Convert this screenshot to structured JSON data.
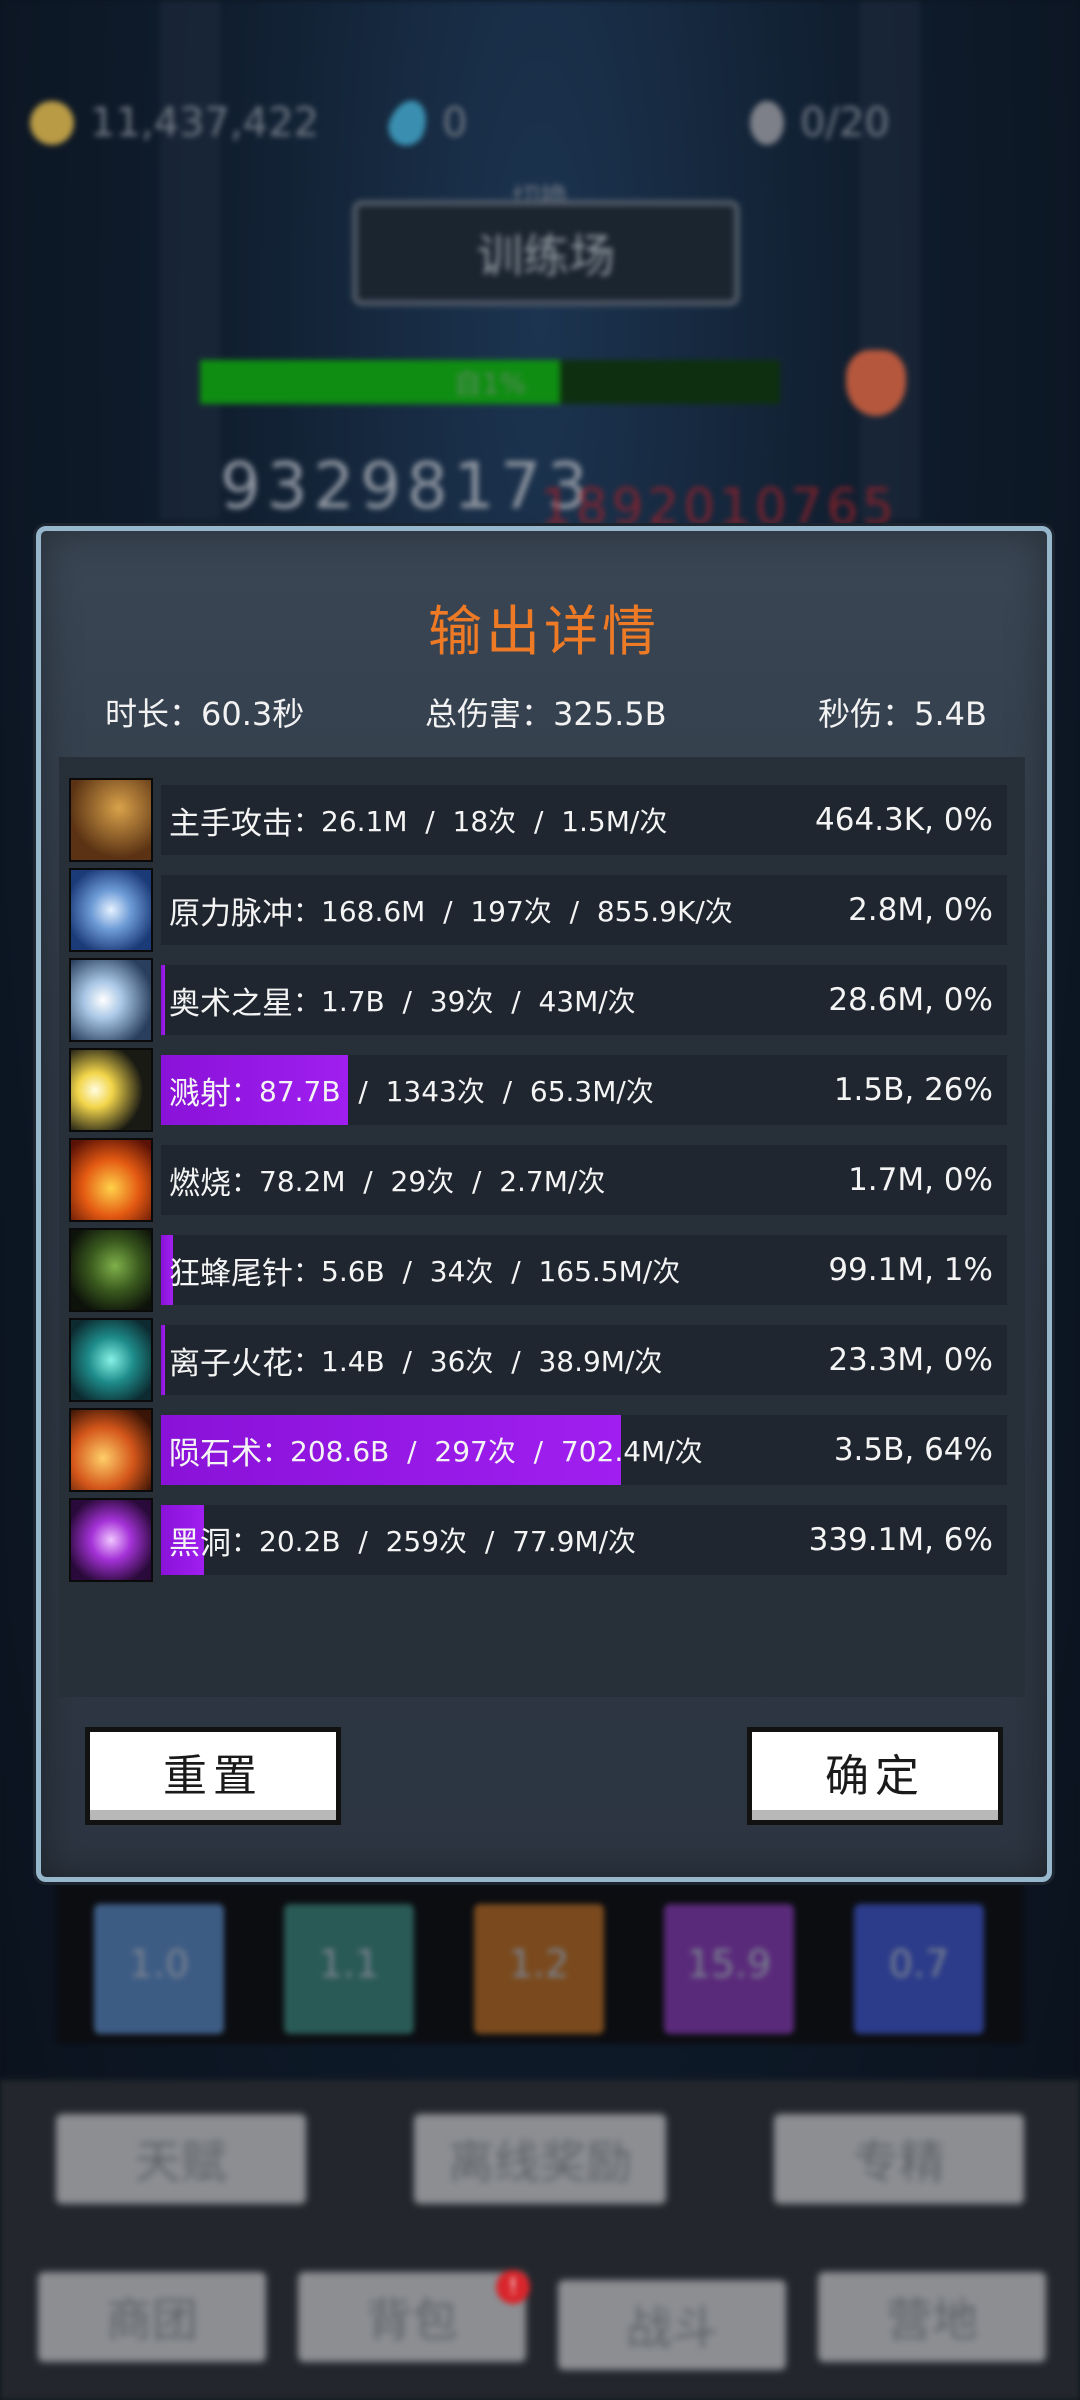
{
  "background": {
    "resources": [
      {
        "icon": "gold-coin-icon",
        "value": "11,437,422"
      },
      {
        "icon": "gem-icon",
        "value": "0"
      },
      {
        "icon": "egg-icon",
        "value": "0/20"
      }
    ],
    "area_switch_label": "切换",
    "area_name": "训练场",
    "boss_hp": {
      "label": "自1%",
      "fraction": 0.62
    },
    "floating_damage": "93298173",
    "floating_damage_red": "1892010765",
    "skill_slots": [
      {
        "label": "1.0",
        "color": "#3d5c84"
      },
      {
        "label": "1.1",
        "color": "#2a5a56"
      },
      {
        "label": "1.2",
        "color": "#7a4a1e"
      },
      {
        "label": "15.9",
        "color": "#5a2a7a"
      },
      {
        "label": "0.7",
        "color": "#2c3c8a"
      }
    ],
    "menu_buttons": [
      "天赋",
      "离线奖励",
      "专精"
    ],
    "nav_buttons": [
      "商团",
      "背包",
      "战斗",
      "营地"
    ],
    "nav_badge": "!"
  },
  "dialog": {
    "title": "输出详情",
    "duration": "时长：60.3秒",
    "total_damage": "总伤害：325.5B",
    "dps": "秒伤：5.4B",
    "skills": [
      {
        "name": "主手攻击",
        "stats": "：26.1M  /  18次  /  1.5M/次",
        "dps_share": "464.3K, 0%",
        "percent": 0,
        "icon": "sword-icon"
      },
      {
        "name": "原力脉冲",
        "stats": "：168.6M  /  197次  /  855.9K/次",
        "dps_share": "2.8M, 0%",
        "percent": 0,
        "icon": "force-pulse-icon"
      },
      {
        "name": "奥术之星",
        "stats": "：1.7B  /  39次  /  43M/次",
        "dps_share": "28.6M, 0%",
        "percent": 0.5,
        "icon": "arcane-star-icon"
      },
      {
        "name": "溅射",
        "stats": "：87.7B  /  1343次  /  65.3M/次",
        "dps_share": "1.5B, 26%",
        "percent": 26,
        "icon": "splash-icon"
      },
      {
        "name": "燃烧",
        "stats": "：78.2M  /  29次  /  2.7M/次",
        "dps_share": "1.7M, 0%",
        "percent": 0,
        "icon": "burn-icon"
      },
      {
        "name": "狂蜂尾针",
        "stats": "：5.6B  /  34次  /  165.5M/次",
        "dps_share": "99.1M, 1%",
        "percent": 1.6,
        "icon": "bee-sting-icon"
      },
      {
        "name": "离子火花",
        "stats": "：1.4B  /  36次  /  38.9M/次",
        "dps_share": "23.3M, 0%",
        "percent": 0.5,
        "icon": "ion-spark-icon"
      },
      {
        "name": "陨石术",
        "stats": "：208.6B  /  297次  /  702.4M/次",
        "dps_share": "3.5B, 64%",
        "percent": 64,
        "icon": "meteor-icon"
      },
      {
        "name": "黑洞",
        "stats": "：20.2B  /  259次  /  77.9M/次",
        "dps_share": "339.1M, 6%",
        "percent": 6,
        "icon": "black-hole-icon"
      }
    ],
    "reset_label": "重置",
    "confirm_label": "确定"
  }
}
